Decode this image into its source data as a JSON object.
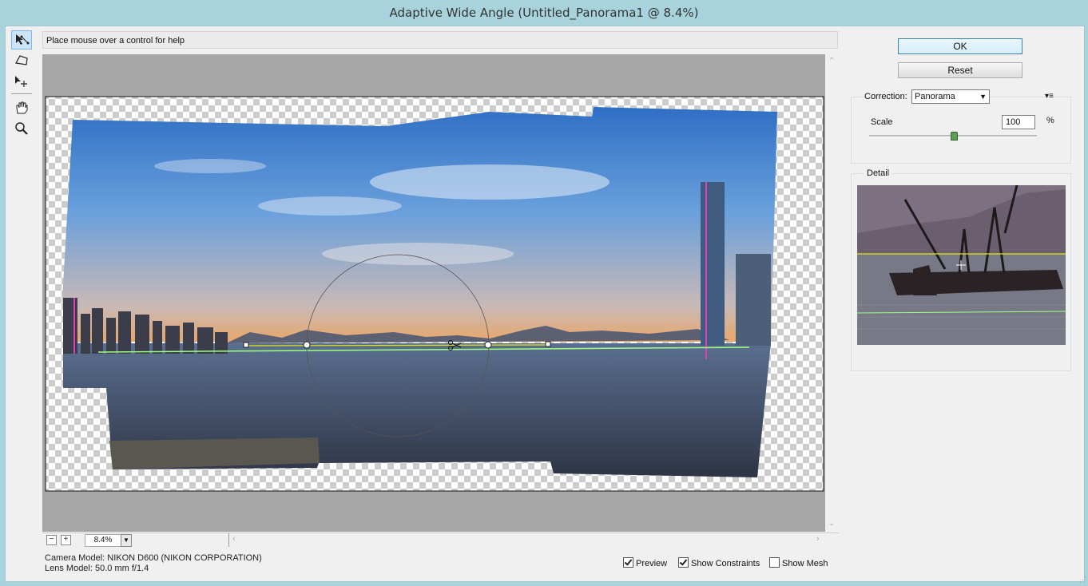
{
  "window": {
    "title": "Adaptive Wide Angle (Untitled_Panorama1 @ 8.4%)"
  },
  "tools": [
    {
      "name": "constraint-tool",
      "active": true
    },
    {
      "name": "polygon-constraint-tool",
      "active": false
    },
    {
      "name": "move-tool",
      "active": false
    },
    {
      "name": "hand-tool",
      "active": false
    },
    {
      "name": "zoom-tool",
      "active": false
    }
  ],
  "help": {
    "text": "Place mouse over a control for help"
  },
  "zoom": {
    "value": "8.4%"
  },
  "camera": {
    "model": "Camera Model: NIKON D600 (NIKON CORPORATION)",
    "lens": "Lens Model: 50.0 mm f/1.4"
  },
  "options": {
    "preview": {
      "label": "Preview",
      "checked": true
    },
    "show_constraints": {
      "label": "Show Constraints",
      "checked": true
    },
    "show_mesh": {
      "label": "Show Mesh",
      "checked": false
    }
  },
  "buttons": {
    "ok": "OK",
    "reset": "Reset"
  },
  "correction": {
    "label": "Correction:",
    "selected": "Panorama",
    "scale_label": "Scale",
    "scale_value": "100",
    "scale_unit": "%",
    "scale_fraction": 0.5
  },
  "detail": {
    "label": "Detail"
  },
  "colors": {
    "constraint_horizontal": "#a0ff80",
    "constraint_vertical": "#e040c0",
    "detail_yellow": "#e6e60a",
    "accent": "#3c7fb1"
  }
}
